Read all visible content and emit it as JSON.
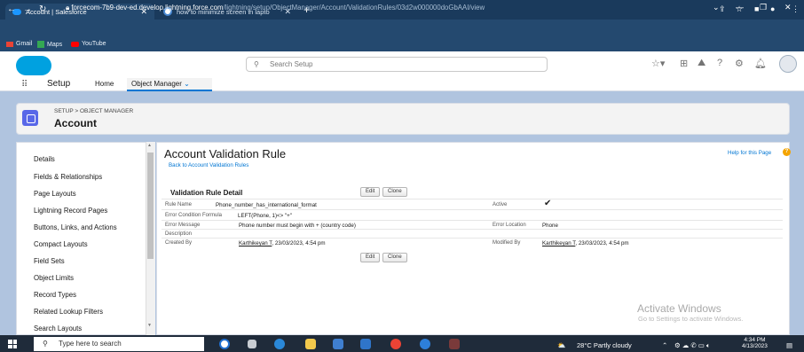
{
  "browser": {
    "tabs": [
      {
        "label": "Account | Salesforce"
      },
      {
        "label": "how to minimize screen in lapto"
      }
    ],
    "url_main": "forcecom-7b9-dev-ed.develop.lightning.force.com",
    "url_path": "/lightning/setup/ObjectManager/Account/ValidationRules/03d2w000000doGbAAI/view",
    "bookmarks": [
      "Gmail",
      "Maps",
      "YouTube"
    ]
  },
  "sf": {
    "search_placeholder": "Search Setup",
    "app_name": "Setup",
    "nav_tabs": [
      "Home",
      "Object Manager"
    ]
  },
  "object": {
    "breadcrumb": "SETUP > OBJECT MANAGER",
    "name": "Account"
  },
  "sidebar": {
    "items": [
      "Details",
      "Fields & Relationships",
      "Page Layouts",
      "Lightning Record Pages",
      "Buttons, Links, and Actions",
      "Compact Layouts",
      "Field Sets",
      "Object Limits",
      "Record Types",
      "Related Lookup Filters",
      "Search Layouts"
    ]
  },
  "main": {
    "title": "Account Validation Rule",
    "back_link": "Back to Account Validation Rules",
    "help_link": "Help for this Page",
    "section_title": "Validation Rule Detail",
    "edit_label": "Edit",
    "clone_label": "Clone",
    "fields": {
      "rule_name_label": "Rule Name",
      "rule_name": "Phone_number_has_international_format",
      "active_label": "Active",
      "error_condition_label": "Error Condition Formula",
      "error_condition": "LEFT(Phone, 1)<> \"+\"",
      "error_message_label": "Error Message",
      "error_message": "Phone number must begin with + (country code)",
      "error_location_label": "Error Location",
      "error_location": "Phone",
      "description_label": "Description",
      "created_by_label": "Created By",
      "created_by_name": "Karthikeyan T",
      "created_by_date": ", 23/03/2023, 4:54 pm",
      "modified_by_label": "Modified By",
      "modified_by_name": "Karthikeyan T",
      "modified_by_date": ", 23/03/2023, 4:54 pm"
    }
  },
  "watermark": {
    "line1": "Activate Windows",
    "line2": "Go to Settings to activate Windows."
  },
  "taskbar": {
    "search_placeholder": "Type here to search",
    "weather": "28°C  Partly cloudy",
    "time": "4:34 PM",
    "date": "4/13/2023"
  }
}
